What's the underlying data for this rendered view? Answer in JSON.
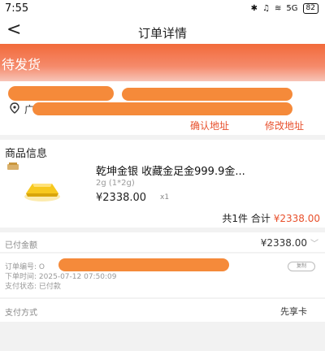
{
  "status_bar": {
    "time": "7:55",
    "network": "5G",
    "battery": "82"
  },
  "nav": {
    "back_glyph": "<",
    "title": "订单详情"
  },
  "banner": {
    "status": "待发货"
  },
  "address": {
    "name_initial": "",
    "address_initial": "广",
    "confirm_label": "确认地址",
    "edit_label": "修改地址",
    "redaction_color": "#f58a3a"
  },
  "goods": {
    "section_title": "商品信息",
    "name": "乾坤金银 收藏金足金999.9金...",
    "spec": "2g (1*2g)",
    "price": "¥2338.00",
    "qty": "x1",
    "summary_count": "共1件",
    "summary_label": "合计",
    "summary_total": "¥2338.00"
  },
  "payment": {
    "paid_label": "已付金额",
    "paid_amount": "¥2338.00",
    "order_no_label": "订单编号:",
    "order_no_value": "O",
    "order_time_label": "下单时间:",
    "order_time_value": "2025-07-12 07:50:09",
    "pay_status_label": "支付状态:",
    "pay_status_value": "已付款",
    "copy_label": "复制",
    "method_label": "支付方式",
    "method_value": "先享卡"
  },
  "colors": {
    "accent": "#e8502c",
    "banner": "#f26a3a"
  }
}
